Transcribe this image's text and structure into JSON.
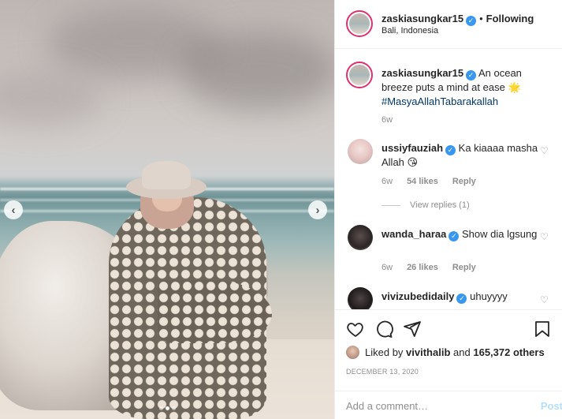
{
  "post": {
    "username": "zaskiasungkar15",
    "follow_status": "Following",
    "location": "Bali, Indonesia",
    "verified_glyph": "✓",
    "separator": "•"
  },
  "caption": {
    "username": "zaskiasungkar15",
    "text": "An ocean breeze puts a mind at ease",
    "emoji": "🌟",
    "hashtag": "#MasyaAllahTabarakallah",
    "time": "6w"
  },
  "comments": [
    {
      "username": "ussiyfauziah",
      "text": "Ka kiaaaa masha Allah",
      "emoji": "😘",
      "time": "6w",
      "likes": "54 likes",
      "reply": "Reply",
      "verified": true
    },
    {
      "username": "wanda_haraa",
      "text": "Show dia lgsung",
      "time": "6w",
      "likes": "26 likes",
      "reply": "Reply",
      "verified": true
    },
    {
      "username": "vivizubedidaily",
      "text": "uhuyyyy",
      "verified": true
    }
  ],
  "view_replies": "View replies (1)",
  "likes": {
    "prefix": "Liked by",
    "user": "vivithalib",
    "connector": "and",
    "count": "165,372 others"
  },
  "date": "DECEMBER 13, 2020",
  "composer": {
    "placeholder": "Add a comment…",
    "post_label": "Post"
  },
  "photo_nav": {
    "prev": "‹",
    "next": "›",
    "slides": 3,
    "active_slide": 2
  },
  "icons": {
    "heart": "heart-icon",
    "comment": "comment-icon",
    "share": "share-icon",
    "save": "bookmark-icon"
  },
  "colors": {
    "verified": "#3897f0",
    "story_ring": "#e1306c",
    "hashtag": "#00376b",
    "muted": "#8e8e8e",
    "post_disabled": "#b2dffc"
  }
}
